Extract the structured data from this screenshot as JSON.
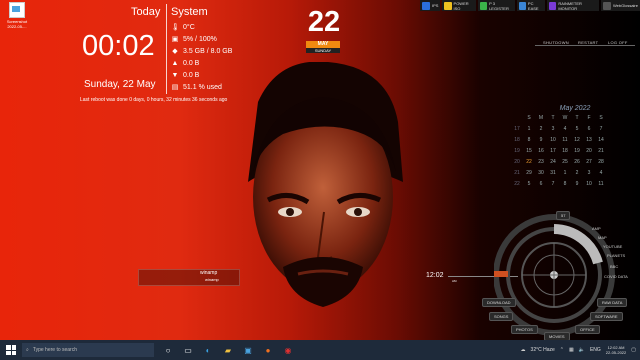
{
  "desktop_icon": {
    "label": "Screenshot",
    "sub": "2022-05-..."
  },
  "widget": {
    "today_label": "Today",
    "system_label": "System",
    "time": "00:02",
    "date": "Sunday, 22 May",
    "stats": [
      {
        "icon": "thermometer-icon",
        "value": "0°C"
      },
      {
        "icon": "cpu-icon",
        "value": "5% / 100%"
      },
      {
        "icon": "ram-icon",
        "value": "3.5 GB / 8.0 GB"
      },
      {
        "icon": "upload-icon",
        "value": "0.0 B"
      },
      {
        "icon": "download-icon",
        "value": "0.0 B"
      },
      {
        "icon": "disk-icon",
        "value": "51.1 % used"
      }
    ],
    "reboot": "Last reboot was done 0 days, 0 hours, 32 minutes 36 seconds ago"
  },
  "date_badge": {
    "day": "22",
    "month": "MAY",
    "weekday": "SUNDAY"
  },
  "top_apps": [
    {
      "label": "IPS",
      "color": "#2a6fdb"
    },
    {
      "label": "POWER ISO",
      "color": "#f0c020"
    },
    {
      "label": "P 3 LEGISTER",
      "color": "#3bb34a"
    },
    {
      "label": "PC EASE",
      "color": "#3b86d6"
    },
    {
      "label": "RAINMETER MONITOR",
      "color": "#7a3bd6"
    },
    {
      "label": "WebGlossaire",
      "color": "#555555"
    }
  ],
  "power": {
    "shutdown": "SHUTDOWN",
    "restart": "RESTART",
    "logoff": "LOG OFF"
  },
  "calendar": {
    "title": "May 2022",
    "rows": [
      [
        "",
        "S",
        "M",
        "T",
        "W",
        "T",
        "F",
        "S"
      ],
      [
        "17",
        "1",
        "2",
        "3",
        "4",
        "5",
        "6",
        "7"
      ],
      [
        "18",
        "8",
        "9",
        "10",
        "11",
        "12",
        "13",
        "14"
      ],
      [
        "19",
        "15",
        "16",
        "17",
        "18",
        "19",
        "20",
        "21"
      ],
      [
        "20",
        "22",
        "23",
        "24",
        "25",
        "26",
        "27",
        "28"
      ],
      [
        "21",
        "29",
        "30",
        "31",
        "1",
        "2",
        "3",
        "4"
      ],
      [
        "22",
        "5",
        "6",
        "7",
        "8",
        "9",
        "10",
        "11"
      ]
    ]
  },
  "media": {
    "title": "winamp",
    "subtitle": "winamp"
  },
  "launcher": {
    "time": "12:02",
    "ampm": "AM",
    "buttons": [
      "DOWNLOAD",
      "SONGS",
      "PHOTOS",
      "MOVIES",
      "OFFICE",
      "SOFTWARE",
      "RAW DATA"
    ],
    "right_labels": [
      "AMP",
      "MAP",
      "YOUTUBE",
      "PLANETS",
      "BBC",
      "COVID DATA"
    ],
    "percent": "57"
  },
  "taskbar": {
    "search_placeholder": "Type here to search",
    "weather": "32°C Haze",
    "lang": "ENG",
    "time": "12:02 AM",
    "date": "22-05-2022"
  }
}
